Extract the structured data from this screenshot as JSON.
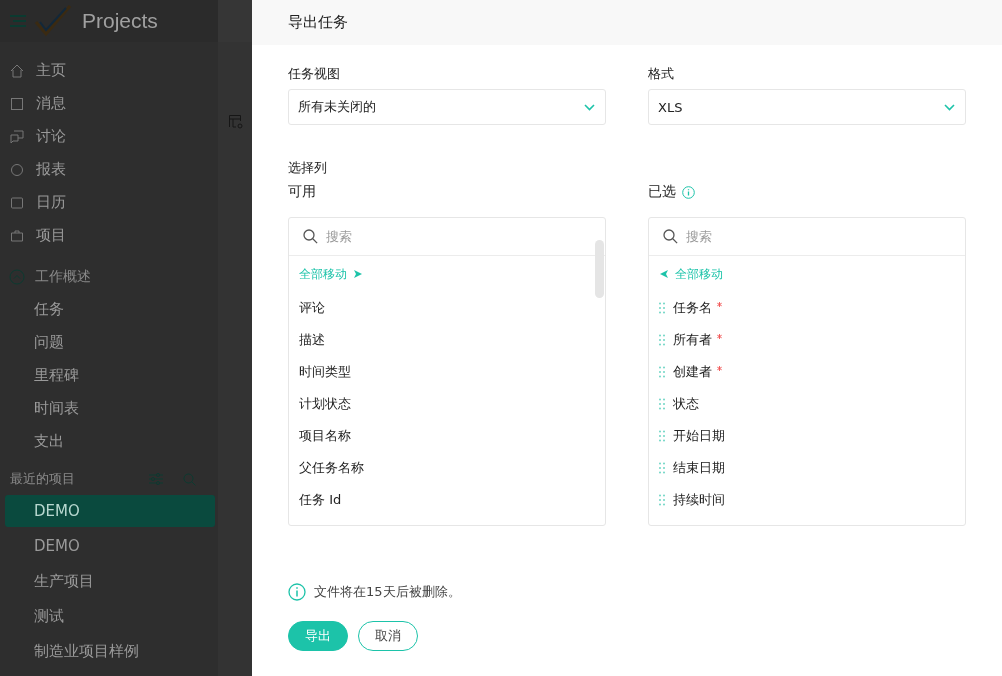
{
  "sidebar": {
    "app_name": "Projects",
    "nav": [
      {
        "label": "主页"
      },
      {
        "label": "消息"
      },
      {
        "label": "讨论"
      },
      {
        "label": "报表"
      },
      {
        "label": "日历"
      },
      {
        "label": "项目"
      }
    ],
    "section": {
      "label": "工作概述",
      "expanded": true,
      "items": [
        "任务",
        "问题",
        "里程碑",
        "时间表",
        "支出"
      ]
    },
    "recent": {
      "label": "最近的项目",
      "projects": [
        {
          "label": "DEMO",
          "selected": true
        },
        {
          "label": "DEMO",
          "selected": false
        },
        {
          "label": "生产项目",
          "selected": false
        },
        {
          "label": "测试",
          "selected": false
        },
        {
          "label": "制造业项目样例",
          "selected": false
        }
      ]
    }
  },
  "dialog": {
    "title": "导出任务",
    "task_view": {
      "label": "任务视图",
      "value": "所有未关闭的"
    },
    "format": {
      "label": "格式",
      "value": "XLS"
    },
    "columns_label": "选择列",
    "available": {
      "label": "可用",
      "search_placeholder": "搜索",
      "move_all": "全部移动",
      "items": [
        "评论",
        "描述",
        "时间类型",
        "计划状态",
        "项目名称",
        "父任务名称",
        "任务 Id"
      ]
    },
    "selected": {
      "label": "已选",
      "search_placeholder": "搜索",
      "move_all": "全部移动",
      "items": [
        {
          "label": "任务名",
          "required": true
        },
        {
          "label": "所有者",
          "required": true
        },
        {
          "label": "创建者",
          "required": true
        },
        {
          "label": "状态",
          "required": false
        },
        {
          "label": "开始日期",
          "required": false
        },
        {
          "label": "结束日期",
          "required": false
        },
        {
          "label": "持续时间",
          "required": false
        }
      ]
    },
    "note": "文件将在15天后被删除。",
    "buttons": [
      {
        "label": "导出",
        "kind": "primary"
      },
      {
        "label": "取消",
        "kind": "secondary"
      }
    ]
  }
}
